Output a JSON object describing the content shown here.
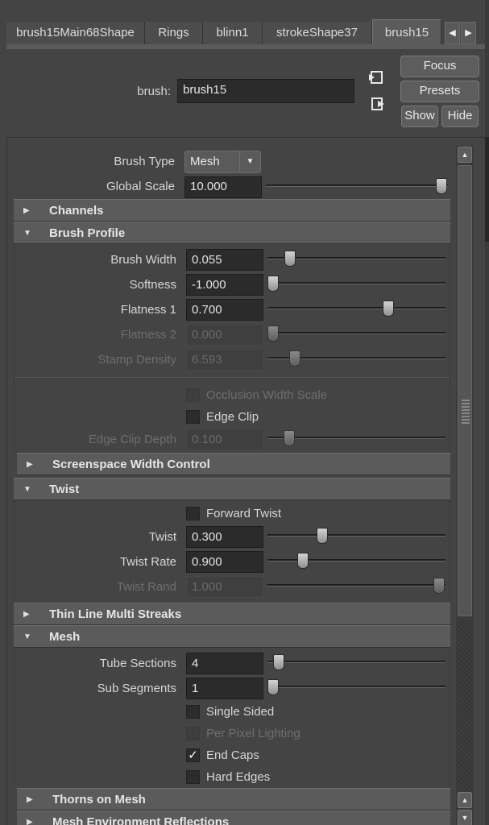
{
  "tabs": [
    {
      "label": "brush15Main68Shape"
    },
    {
      "label": "Rings"
    },
    {
      "label": "blinn1"
    },
    {
      "label": "strokeShape37"
    },
    {
      "label": "brush15",
      "active": true
    }
  ],
  "tab_scroll": {
    "left_icon": "triangle-left-icon",
    "right_icon": "triangle-right-icon"
  },
  "header": {
    "node_label": "brush:",
    "node_value": "brush15",
    "focus_label": "Focus",
    "presets_label": "Presets",
    "show_label": "Show",
    "hide_label": "Hide"
  },
  "top_attrs": {
    "brush_type_label": "Brush Type",
    "brush_type_value": "Mesh",
    "global_scale_label": "Global Scale",
    "global_scale_value": "10.000",
    "global_scale_slider": 1.0
  },
  "frames": {
    "channels": "Channels",
    "brush_profile": "Brush Profile",
    "screenspace": "Screenspace Width Control",
    "twist": "Twist",
    "thin_line": "Thin Line Multi Streaks",
    "mesh": "Mesh",
    "thorns": "Thorns on Mesh",
    "mesh_env": "Mesh Environment Reflections"
  },
  "brush_profile": {
    "brush_width_label": "Brush Width",
    "brush_width_value": "0.055",
    "brush_width_slider": 0.13,
    "softness_label": "Softness",
    "softness_value": "-1.000",
    "softness_slider": 0.0,
    "flatness1_label": "Flatness 1",
    "flatness1_value": "0.700",
    "flatness1_slider": 0.7,
    "flatness2_label": "Flatness 2",
    "flatness2_value": "0.000",
    "flatness2_slider": 0.0,
    "stamp_density_label": "Stamp Density",
    "stamp_density_value": "6.593",
    "stamp_density_slider": 0.13,
    "occlusion_label": "Occlusion Width Scale",
    "occlusion_checked": false,
    "edge_clip_label": "Edge Clip",
    "edge_clip_checked": false,
    "edge_clip_depth_label": "Edge Clip Depth",
    "edge_clip_depth_value": "0.100",
    "edge_clip_depth_slider": 0.1
  },
  "twist": {
    "forward_twist_label": "Forward Twist",
    "forward_twist_checked": false,
    "twist_label": "Twist",
    "twist_value": "0.300",
    "twist_slider": 0.3,
    "twist_rate_label": "Twist Rate",
    "twist_rate_value": "0.900",
    "twist_rate_slider": 0.2,
    "twist_rand_label": "Twist Rand",
    "twist_rand_value": "1.000",
    "twist_rand_slider": 1.0
  },
  "mesh": {
    "tube_sections_label": "Tube Sections",
    "tube_sections_value": "4",
    "tube_sections_slider": 0.03,
    "sub_segments_label": "Sub Segments",
    "sub_segments_value": "1",
    "sub_segments_slider": 0.0,
    "single_sided_label": "Single Sided",
    "single_sided_checked": false,
    "per_pixel_label": "Per Pixel Lighting",
    "per_pixel_checked": false,
    "end_caps_label": "End Caps",
    "end_caps_checked": true,
    "hard_edges_label": "Hard Edges",
    "hard_edges_checked": false
  },
  "colors": {
    "background": "#444444",
    "field": "#2b2b2b",
    "frame_header": "#5b5b5b"
  }
}
